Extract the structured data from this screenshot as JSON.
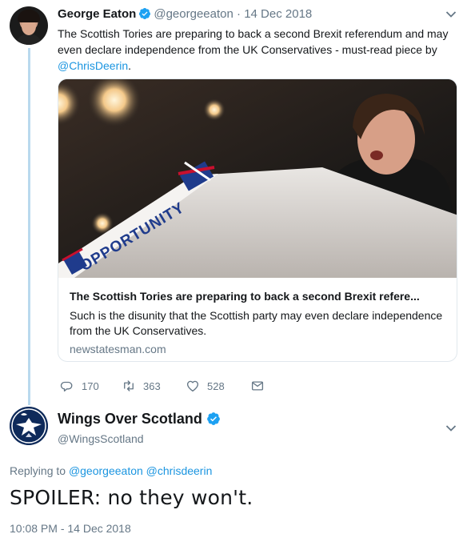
{
  "tweet1": {
    "author_name": "George Eaton",
    "handle": "@georgeeaton",
    "separator": "·",
    "date": "14 Dec 2018",
    "text_before_link": "The Scottish Tories are preparing to back a second Brexit referendum and may even declare independence from the UK Conservatives - must-read piece by ",
    "mention_link": "@ChrisDeerin",
    "text_after_link": ".",
    "card": {
      "image_text": "OPPORTUNITY",
      "title": "The Scottish Tories are preparing to back a second Brexit refere...",
      "description": "Such is the disunity that the Scottish party may even declare independence from the UK Conservatives.",
      "domain": "newstatesman.com"
    },
    "actions": {
      "replies": "170",
      "retweets": "363",
      "likes": "528"
    }
  },
  "tweet2": {
    "author_name": "Wings Over Scotland",
    "handle": "@WingsScotland",
    "replying_prefix": "Replying to",
    "replying_to_1": "@georgeeaton",
    "replying_to_2": "@chrisdeerin",
    "text": "SPOILER: no they won't.",
    "timestamp": "10:08 PM - 14 Dec 2018"
  },
  "colors": {
    "link": "#1b95e0",
    "muted": "#657786",
    "thread_line": "#b9d9ee",
    "verified": "#1da1f2"
  },
  "icons": [
    "verified-icon",
    "chevron-down-icon",
    "reply-icon",
    "retweet-icon",
    "like-icon",
    "direct-message-icon"
  ]
}
